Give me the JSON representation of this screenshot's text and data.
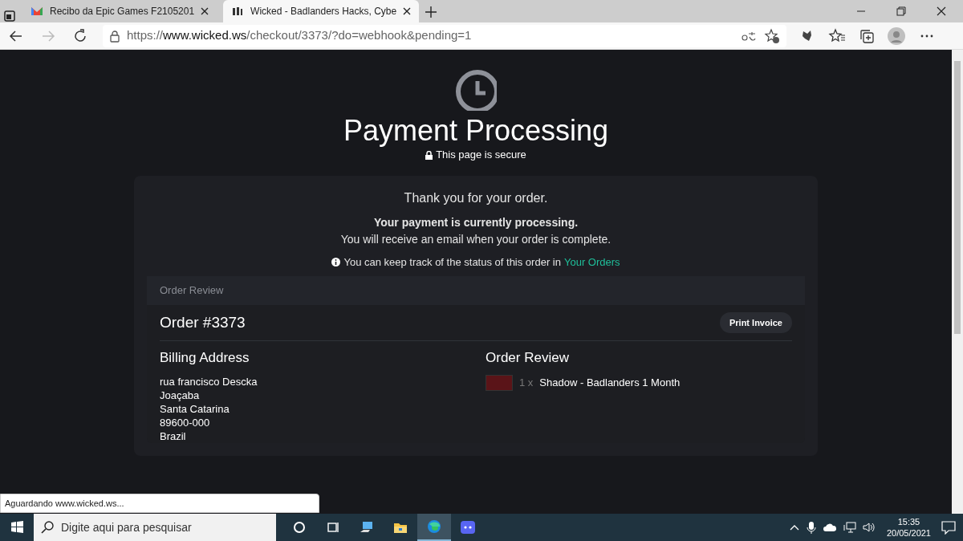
{
  "browser": {
    "tabs": [
      {
        "title": "Recibo da Epic Games F2105201",
        "kind": "mail",
        "selected": false
      },
      {
        "title": "Wicked - Badlanders Hacks, Cybe",
        "kind": "site",
        "selected": true
      }
    ],
    "url": {
      "host_prefix": "https://",
      "host": "www.wicked.ws",
      "path": "/checkout/3373/?do=webhook&pending=1"
    },
    "status_text": "Aguardando www.wicked.ws..."
  },
  "page": {
    "title": "Payment Processing",
    "secure_note": "This page is secure",
    "thanks": "Thank you for your order.",
    "processing": "Your payment is currently processing.",
    "email_note": "You will receive an email when your order is complete.",
    "track_note": "You can keep track of the status of this order in",
    "track_link": "Your Orders",
    "review": {
      "header": "Order Review",
      "order_number": "Order #3373",
      "print_button": "Print Invoice",
      "billing_title": "Billing Address",
      "address_lines": [
        "rua francisco Descka",
        "Joaçaba",
        "Santa Catarina",
        "89600-000",
        "Brazil"
      ],
      "items_title": "Order Review",
      "items": [
        {
          "quantity": "1 x",
          "name": "Shadow - Badlanders 1 Month"
        }
      ]
    }
  },
  "taskbar": {
    "search_placeholder": "Digite aqui para pesquisar",
    "apps": [
      {
        "kind": "cortana",
        "selected": false
      },
      {
        "kind": "taskview",
        "selected": false
      },
      {
        "kind": "pc",
        "selected": false
      },
      {
        "kind": "folder",
        "selected": false
      },
      {
        "kind": "edge",
        "selected": true
      },
      {
        "kind": "discord",
        "selected": false
      }
    ],
    "time": "15:35",
    "date": "20/05/2021"
  }
}
